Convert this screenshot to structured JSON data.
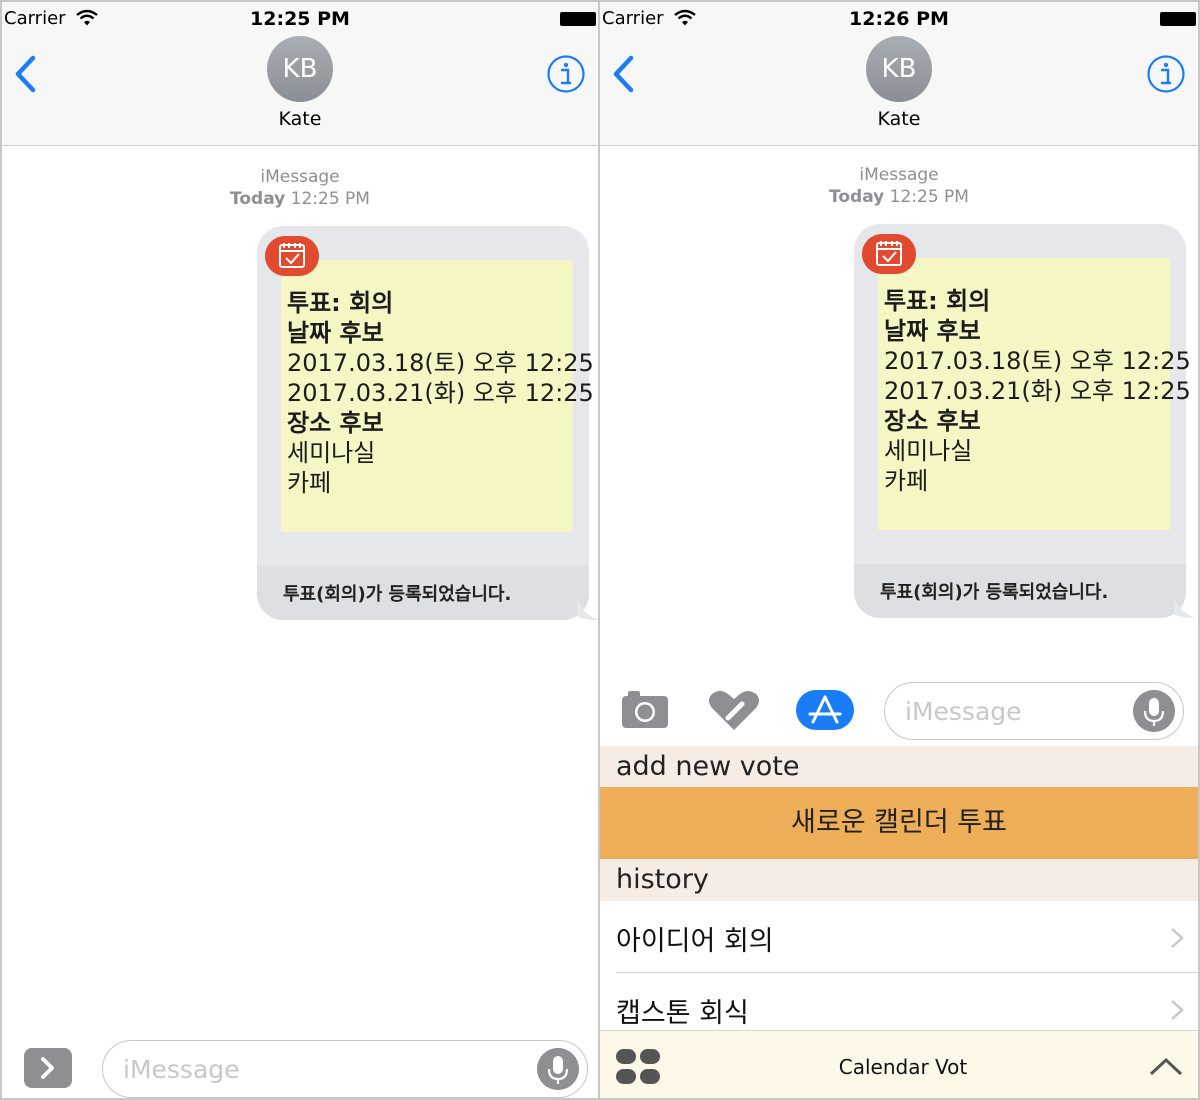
{
  "colors": {
    "ios_blue": "#1a7cf6",
    "bubble_gray": "#e6e7eb",
    "sticky_yellow": "#f6f5c4",
    "app_icon_red": "#e24a2f",
    "new_vote_orange": "#eeae58",
    "section_header_bg": "#f5ece6",
    "app_bar_bg": "#fdf8e8"
  },
  "left": {
    "status": {
      "carrier": "Carrier",
      "time": "12:25 PM"
    },
    "contact": {
      "initials": "KB",
      "name": "Kate"
    },
    "meta": {
      "service": "iMessage",
      "day": "Today",
      "time": "12:25 PM"
    },
    "message": {
      "lines": [
        "투표: 회의",
        "날짜 후보",
        "2017.03.18(토) 오후 12:25",
        "2017.03.21(화) 오후 12:25",
        "장소 후보",
        "세미나실",
        "카페"
      ],
      "caption": "투표(회의)가 등록되었습니다."
    },
    "composer": {
      "placeholder": "iMessage"
    }
  },
  "right": {
    "status": {
      "carrier": "Carrier",
      "time": "12:26 PM"
    },
    "contact": {
      "initials": "KB",
      "name": "Kate"
    },
    "meta": {
      "service": "iMessage",
      "day": "Today",
      "time": "12:25 PM"
    },
    "message": {
      "lines": [
        "투표: 회의",
        "날짜 후보",
        "2017.03.18(토) 오후 12:25",
        "2017.03.21(화) 오후 12:25",
        "장소 후보",
        "세미나실",
        "카페"
      ],
      "caption": "투표(회의)가 등록되었습니다."
    },
    "composer": {
      "placeholder": "iMessage"
    },
    "drawer_icons": [
      "camera-icon",
      "digital-touch-heart-icon",
      "app-store-icon"
    ],
    "extension": {
      "new_section_title": "add new vote",
      "new_vote_button": "새로운 캘린더 투표",
      "history_title": "history",
      "history": [
        "아이디어 회의",
        "캡스톤 회식"
      ],
      "app_name": "Calendar Vot"
    }
  }
}
